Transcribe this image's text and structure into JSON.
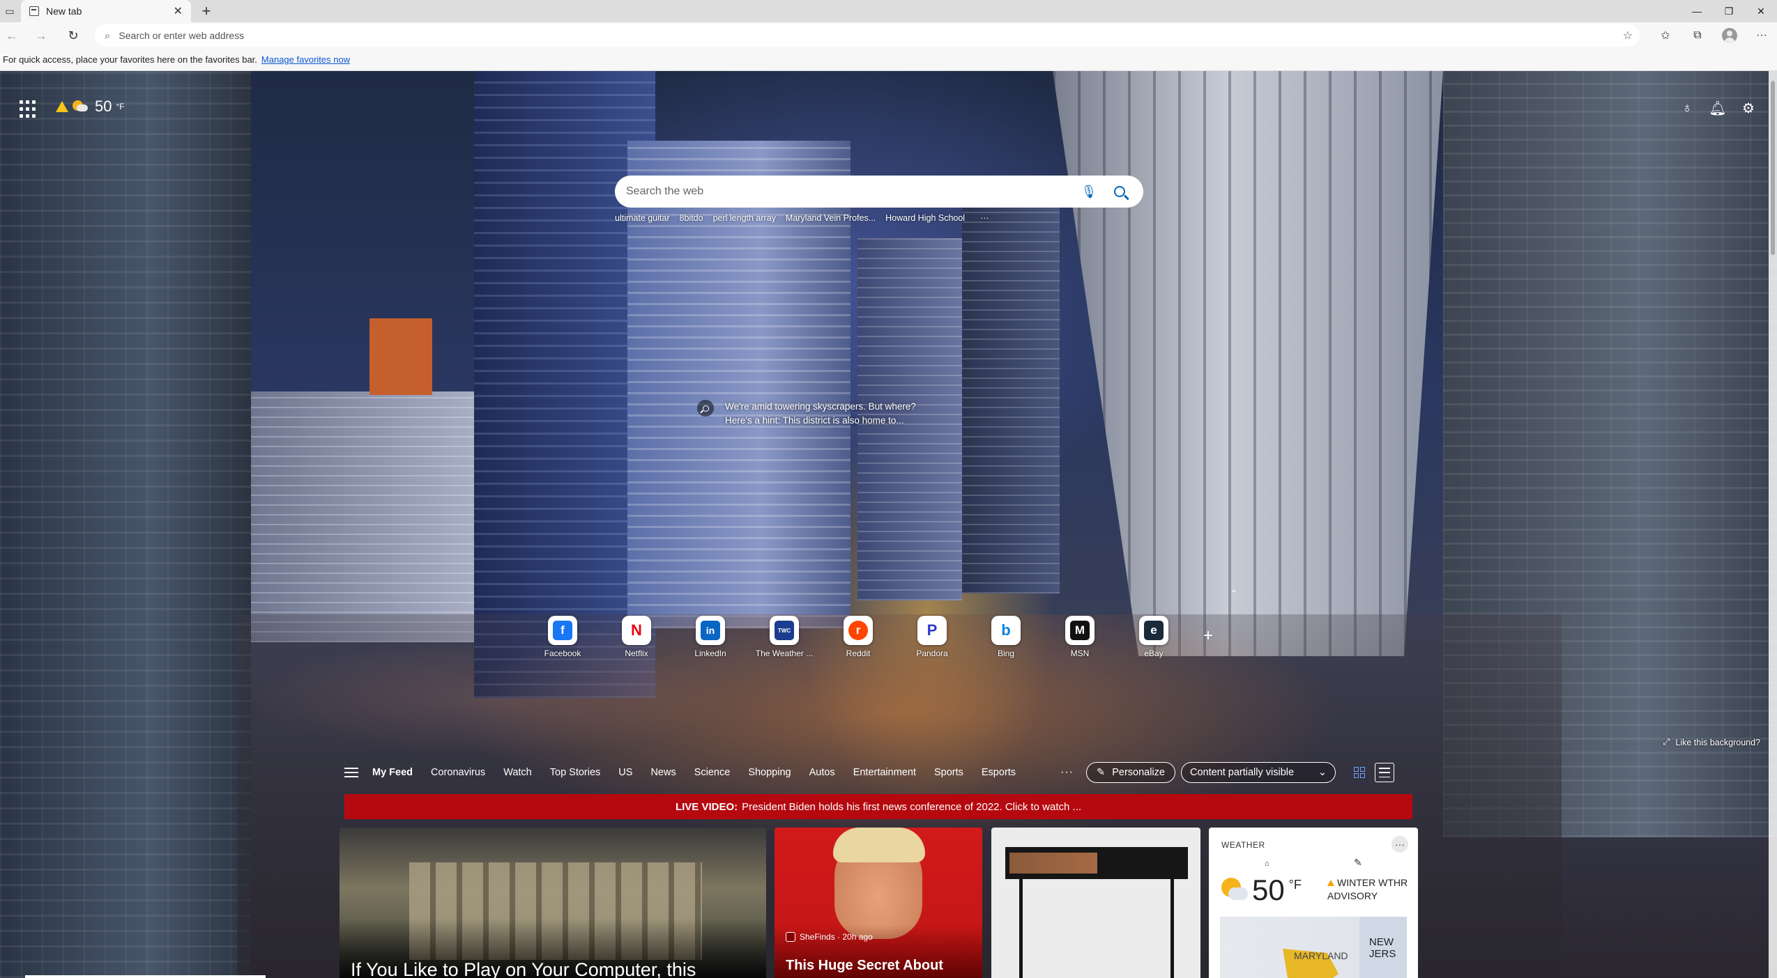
{
  "browser": {
    "tab_title": "New tab",
    "address_placeholder": "Search or enter web address",
    "favorites_bar_text": "For quick access, place your favorites here on the favorites bar.",
    "favorites_bar_link": "Manage favorites now"
  },
  "page": {
    "weather_mini": {
      "temp": "50",
      "unit": "°F"
    },
    "search": {
      "placeholder": "Search the web",
      "trending": [
        "ultimate guitar",
        "8bitdo",
        "perl length array",
        "Maryland Vein Profes...",
        "Howard High School"
      ],
      "trending_more": "···"
    },
    "hint_text": "We're amid towering skyscrapers. But where? Here's a hint: This district is also home to...",
    "quick_links": [
      {
        "label": "Facebook",
        "letter": "f",
        "color": "#1877f2"
      },
      {
        "label": "Netflix",
        "letter": "N",
        "color": "#e50914"
      },
      {
        "label": "LinkedIn",
        "letter": "in",
        "color": "#0a66c2"
      },
      {
        "label": "The Weather ...",
        "letter": "TWC",
        "color": "#1b3d8f"
      },
      {
        "label": "Reddit",
        "letter": "r",
        "color": "#ff4500"
      },
      {
        "label": "Pandora",
        "letter": "P",
        "color": "#2f3bcb"
      },
      {
        "label": "Bing",
        "letter": "b",
        "color": "#0b84d8"
      },
      {
        "label": "MSN",
        "letter": "M",
        "color": "#111111"
      },
      {
        "label": "eBay",
        "letter": "e",
        "color": "#1b2a3a"
      }
    ],
    "like_background": "Like this background?",
    "feed_tabs": [
      "My Feed",
      "Coronavirus",
      "Watch",
      "Top Stories",
      "US",
      "News",
      "Science",
      "Shopping",
      "Autos",
      "Entertainment",
      "Sports",
      "Esports"
    ],
    "feed_more": "···",
    "personalize_label": "Personalize",
    "content_select_value": "Content partially visible",
    "live_banner": {
      "prefix": "LIVE VIDEO:",
      "text": "President Biden holds his first news conference of 2022. Click to watch ..."
    },
    "cards": {
      "card1_title": "If You Like to Play on Your Computer, this",
      "card2_source": "SheFinds · 20h ago",
      "card2_title": "This Huge Secret About",
      "weather": {
        "label": "WEATHER",
        "more": "···",
        "temp": "50",
        "unit": "°F",
        "alert": "WINTER WTHR ADVISORY",
        "map_label_1": "MARYLAND",
        "map_label_2": "NEW JERS"
      }
    }
  }
}
